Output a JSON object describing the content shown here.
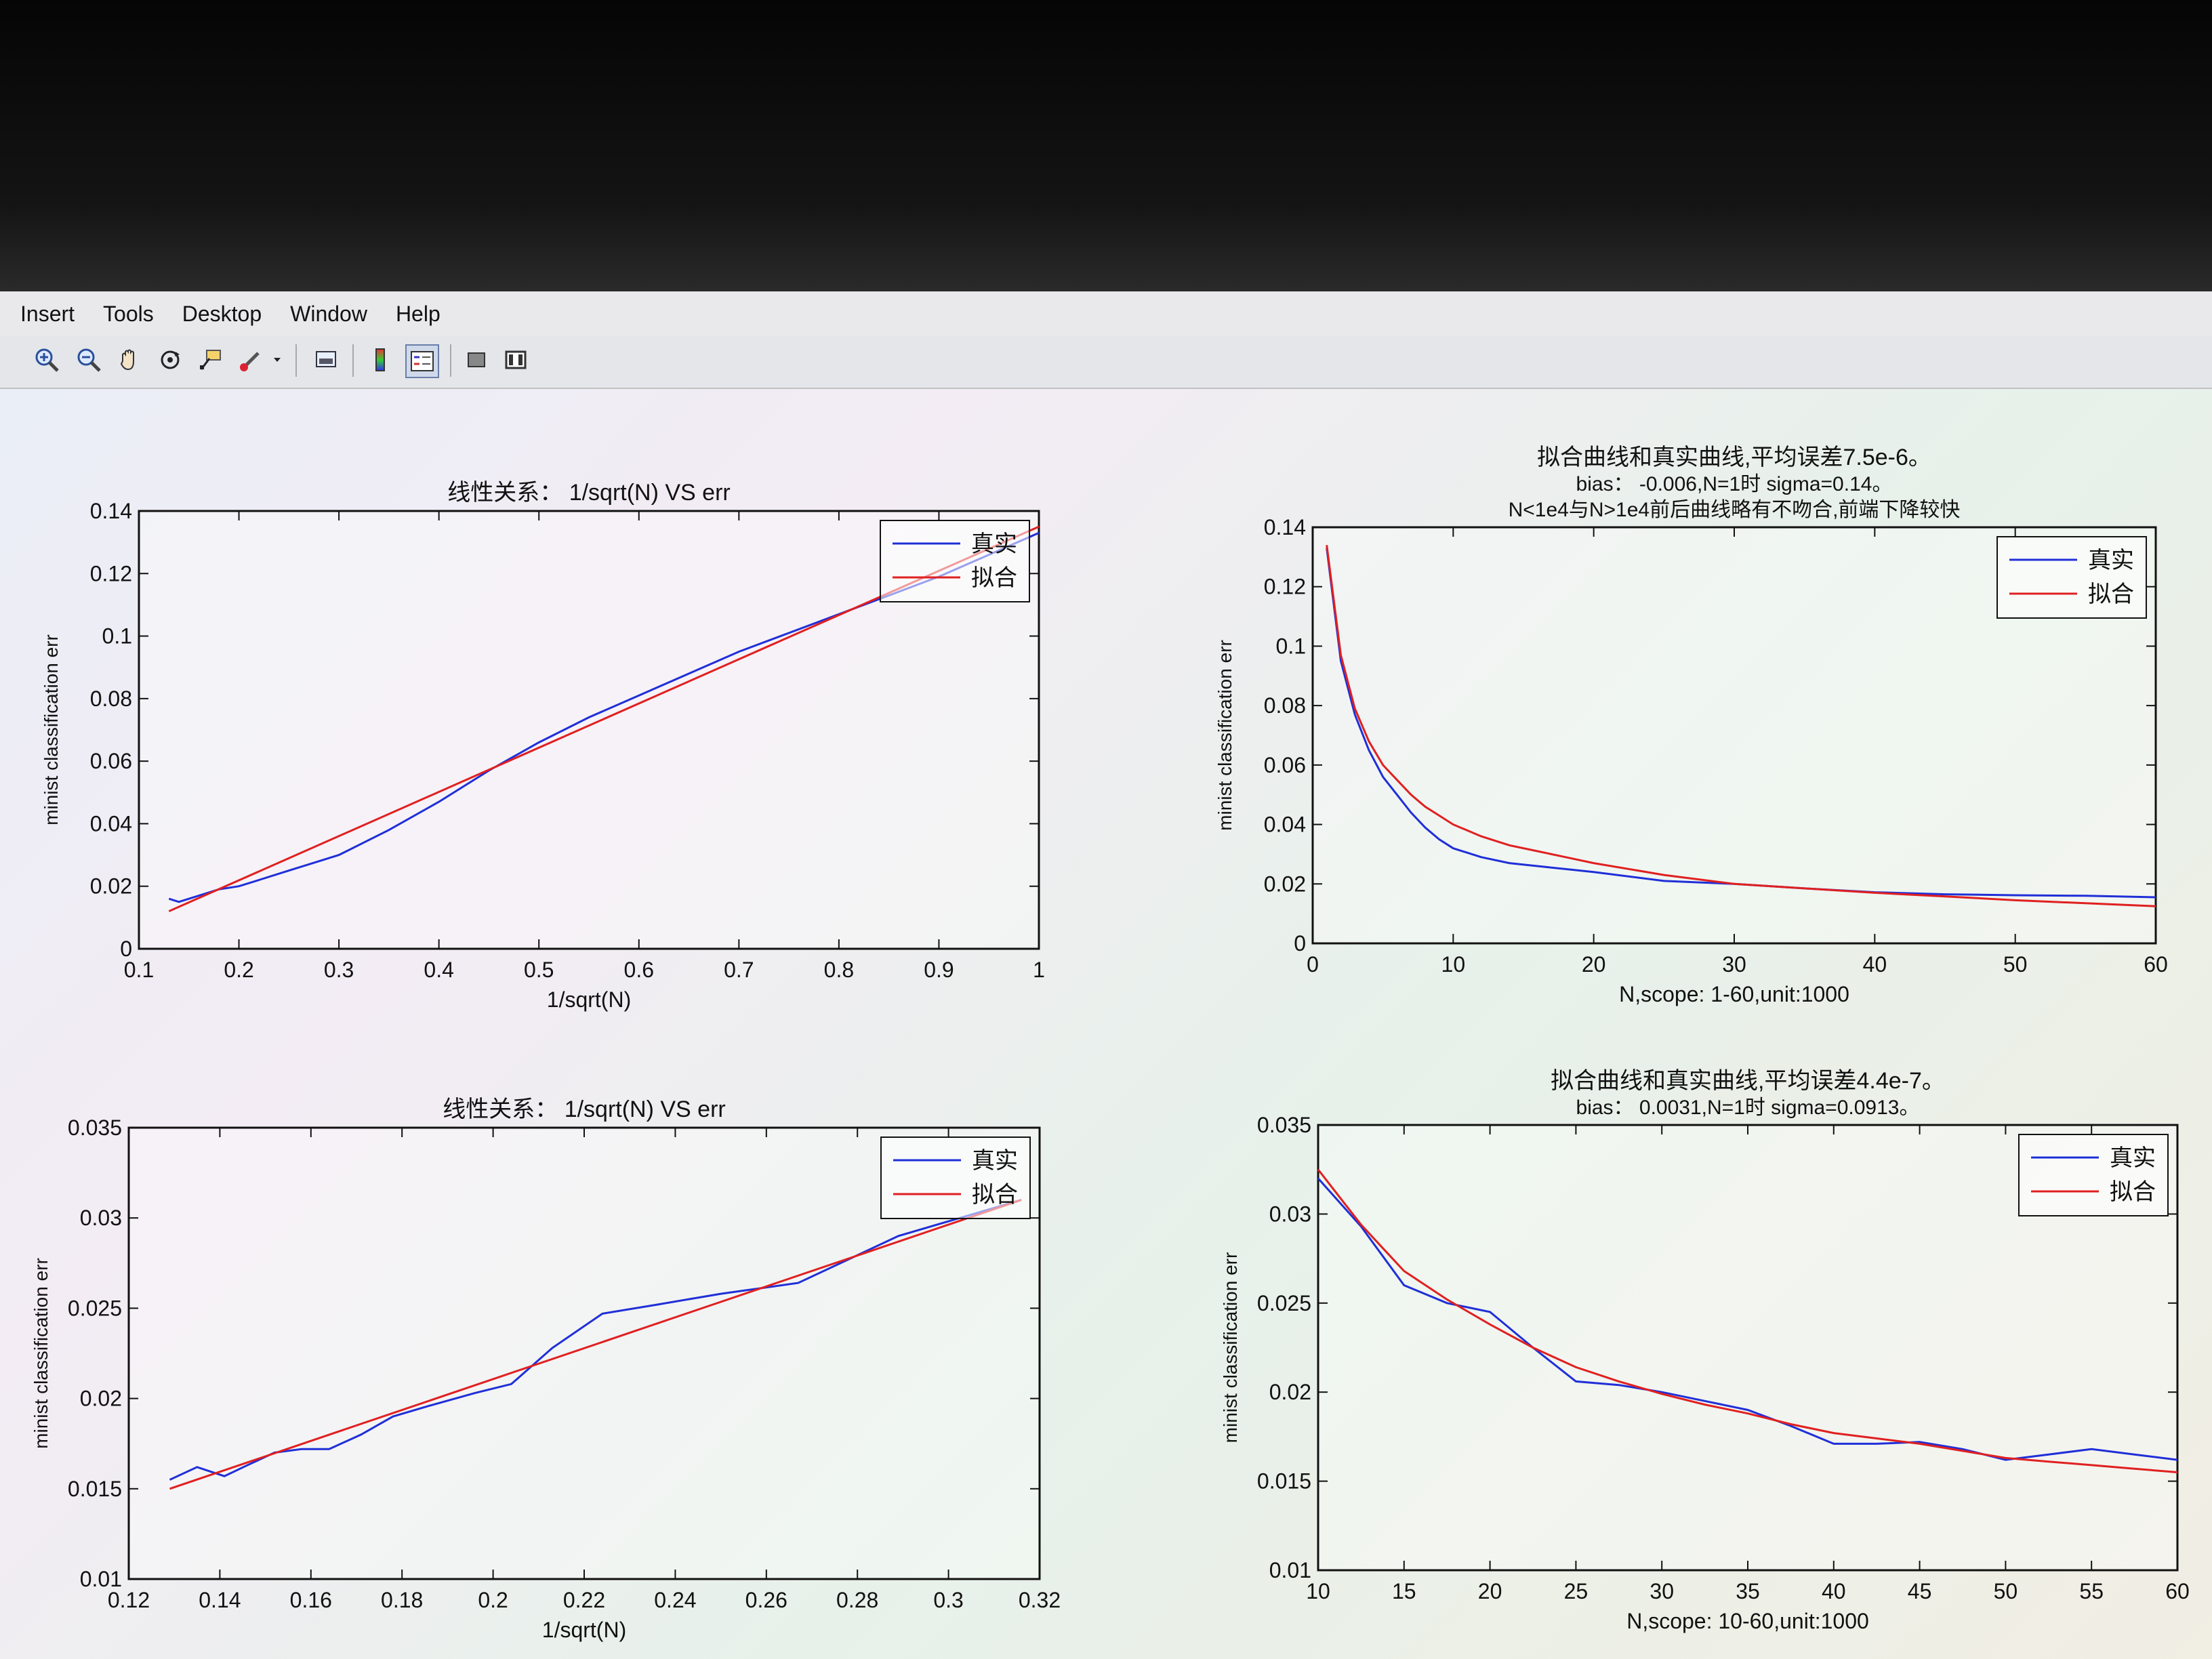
{
  "menu": [
    "Insert",
    "Tools",
    "Desktop",
    "Window",
    "Help"
  ],
  "toolbar_icons": [
    "zoom-in-icon",
    "zoom-out-icon",
    "pan-hand-icon",
    "rotate-3d-icon",
    "data-cursor-icon",
    "brush-icon",
    "dropdown-arrow-icon",
    "link-plot-icon",
    "colorbar-icon",
    "legend-icon",
    "hide-plot-tools-icon",
    "show-plot-tools-icon"
  ],
  "colors": {
    "real": "#1f2fd8",
    "fit": "#e02020"
  },
  "chart_data": [
    {
      "type": "line",
      "title": [
        "线性关系： 1/sqrt(N) VS err"
      ],
      "xlabel": "1/sqrt(N)",
      "ylabel": "minist classification err",
      "xlim": [
        0.1,
        1
      ],
      "ylim": [
        0,
        0.14
      ],
      "xticks": [
        0.1,
        0.2,
        0.3,
        0.4,
        0.5,
        0.6,
        0.7,
        0.8,
        0.9,
        1
      ],
      "xtick_labels": [
        "0.1",
        "0.2",
        "0.3",
        "0.4",
        "0.5",
        "0.6",
        "0.7",
        "0.8",
        "0.9",
        "1"
      ],
      "yticks": [
        0,
        0.02,
        0.04,
        0.06,
        0.08,
        0.1,
        0.12,
        0.14
      ],
      "ytick_labels": [
        "0",
        "0.02",
        "0.04",
        "0.06",
        "0.08",
        "0.1",
        "0.12",
        "0.14"
      ],
      "legend": "top-right",
      "grid": false,
      "series": [
        {
          "name": "真实",
          "color": "#1f2fd8",
          "x": [
            0.13,
            0.14,
            0.16,
            0.18,
            0.2,
            0.22,
            0.25,
            0.3,
            0.35,
            0.4,
            0.45,
            0.5,
            0.55,
            0.6,
            0.65,
            0.7,
            0.75,
            0.8,
            0.85,
            0.9,
            0.95,
            1.0
          ],
          "y": [
            0.016,
            0.015,
            0.017,
            0.019,
            0.02,
            0.022,
            0.025,
            0.03,
            0.038,
            0.047,
            0.057,
            0.066,
            0.074,
            0.081,
            0.088,
            0.095,
            0.101,
            0.107,
            0.113,
            0.119,
            0.126,
            0.133
          ]
        },
        {
          "name": "拟合",
          "color": "#e02020",
          "x": [
            0.13,
            1.0
          ],
          "y": [
            0.012,
            0.135
          ]
        }
      ]
    },
    {
      "type": "line",
      "title": [
        "拟合曲线和真实曲线,平均误差7.5e-6。",
        "bias： -0.006,N=1时 sigma=0.14。",
        "N<1e4与N>1e4前后曲线略有不吻合,前端下降较快"
      ],
      "xlabel": "N,scope: 1-60,unit:1000",
      "ylabel": "minist classification err",
      "xlim": [
        0,
        60
      ],
      "ylim": [
        0,
        0.14
      ],
      "xticks": [
        0,
        10,
        20,
        30,
        40,
        50,
        60
      ],
      "xtick_labels": [
        "0",
        "10",
        "20",
        "30",
        "40",
        "50",
        "60"
      ],
      "yticks": [
        0,
        0.02,
        0.04,
        0.06,
        0.08,
        0.1,
        0.12,
        0.14
      ],
      "ytick_labels": [
        "0",
        "0.02",
        "0.04",
        "0.06",
        "0.08",
        "0.1",
        "0.12",
        "0.14"
      ],
      "legend": "top-right",
      "grid": false,
      "series": [
        {
          "name": "真实",
          "color": "#1f2fd8",
          "x": [
            1,
            2,
            3,
            4,
            5,
            6,
            7,
            8,
            9,
            10,
            12,
            14,
            16,
            18,
            20,
            25,
            30,
            35,
            40,
            45,
            50,
            55,
            60
          ],
          "y": [
            0.133,
            0.095,
            0.077,
            0.065,
            0.056,
            0.05,
            0.044,
            0.039,
            0.035,
            0.032,
            0.029,
            0.027,
            0.026,
            0.025,
            0.024,
            0.021,
            0.02,
            0.0185,
            0.0172,
            0.0165,
            0.0162,
            0.016,
            0.0155
          ]
        },
        {
          "name": "拟合",
          "color": "#e02020",
          "x": [
            1,
            2,
            3,
            4,
            5,
            6,
            7,
            8,
            9,
            10,
            12,
            14,
            16,
            18,
            20,
            25,
            30,
            35,
            40,
            45,
            50,
            55,
            60
          ],
          "y": [
            0.134,
            0.097,
            0.079,
            0.068,
            0.06,
            0.055,
            0.05,
            0.046,
            0.043,
            0.04,
            0.036,
            0.033,
            0.031,
            0.029,
            0.027,
            0.023,
            0.02,
            0.0185,
            0.017,
            0.0158,
            0.0145,
            0.0135,
            0.0125
          ]
        }
      ]
    },
    {
      "type": "line",
      "title": [
        "线性关系： 1/sqrt(N) VS err"
      ],
      "xlabel": "1/sqrt(N)",
      "ylabel": "minist classification err",
      "xlim": [
        0.12,
        0.32
      ],
      "ylim": [
        0.01,
        0.035
      ],
      "xticks": [
        0.12,
        0.14,
        0.16,
        0.18,
        0.2,
        0.22,
        0.24,
        0.26,
        0.28,
        0.3,
        0.32
      ],
      "xtick_labels": [
        "0.12",
        "0.14",
        "0.16",
        "0.18",
        "0.2",
        "0.22",
        "0.24",
        "0.26",
        "0.28",
        "0.3",
        "0.32"
      ],
      "yticks": [
        0.01,
        0.015,
        0.02,
        0.025,
        0.03,
        0.035
      ],
      "ytick_labels": [
        "0.01",
        "0.015",
        "0.02",
        "0.025",
        "0.03",
        "0.035"
      ],
      "legend": "top-right",
      "grid": false,
      "series": [
        {
          "name": "真实",
          "color": "#1f2fd8",
          "x": [
            0.129,
            0.135,
            0.141,
            0.146,
            0.152,
            0.158,
            0.164,
            0.171,
            0.178,
            0.186,
            0.196,
            0.204,
            0.213,
            0.224,
            0.236,
            0.25,
            0.267,
            0.289,
            0.316
          ],
          "y": [
            0.0155,
            0.0162,
            0.0157,
            0.0163,
            0.017,
            0.0172,
            0.0172,
            0.018,
            0.019,
            0.0196,
            0.0203,
            0.0208,
            0.0228,
            0.0247,
            0.0252,
            0.0258,
            0.0264,
            0.029,
            0.031
          ]
        },
        {
          "name": "拟合",
          "color": "#e02020",
          "x": [
            0.129,
            0.316
          ],
          "y": [
            0.015,
            0.031
          ]
        }
      ]
    },
    {
      "type": "line",
      "title": [
        "拟合曲线和真实曲线,平均误差4.4e-7。",
        "bias： 0.0031,N=1时 sigma=0.0913。"
      ],
      "xlabel": "N,scope: 10-60,unit:1000",
      "ylabel": "minist classification err",
      "xlim": [
        10,
        60
      ],
      "ylim": [
        0.01,
        0.035
      ],
      "xticks": [
        10,
        15,
        20,
        25,
        30,
        35,
        40,
        45,
        50,
        55,
        60
      ],
      "xtick_labels": [
        "10",
        "15",
        "20",
        "25",
        "30",
        "35",
        "40",
        "45",
        "50",
        "55",
        "60"
      ],
      "yticks": [
        0.01,
        0.015,
        0.02,
        0.025,
        0.03,
        0.035
      ],
      "ytick_labels": [
        "0.01",
        "0.015",
        "0.02",
        "0.025",
        "0.03",
        "0.035"
      ],
      "legend": "top-right",
      "grid": false,
      "series": [
        {
          "name": "真实",
          "color": "#1f2fd8",
          "x": [
            10,
            12.5,
            15,
            17.5,
            20,
            22.5,
            25,
            27.5,
            30,
            32.5,
            35,
            37.5,
            40,
            42.5,
            45,
            47.5,
            50,
            52.5,
            55,
            57.5,
            60
          ],
          "y": [
            0.032,
            0.0293,
            0.026,
            0.025,
            0.0245,
            0.0225,
            0.0206,
            0.0204,
            0.02,
            0.0195,
            0.019,
            0.0181,
            0.0171,
            0.0171,
            0.0172,
            0.0168,
            0.0162,
            0.0165,
            0.0168,
            0.0165,
            0.0162
          ]
        },
        {
          "name": "拟合",
          "color": "#e02020",
          "x": [
            10,
            12.5,
            15,
            17.5,
            20,
            22.5,
            25,
            27.5,
            30,
            32.5,
            35,
            37.5,
            40,
            42.5,
            45,
            47.5,
            50,
            52.5,
            55,
            57.5,
            60
          ],
          "y": [
            0.0325,
            0.0294,
            0.0268,
            0.0252,
            0.0238,
            0.0225,
            0.0214,
            0.0206,
            0.0199,
            0.0193,
            0.0188,
            0.0182,
            0.0177,
            0.0174,
            0.0171,
            0.0167,
            0.0163,
            0.0161,
            0.0159,
            0.0157,
            0.0155
          ]
        }
      ]
    }
  ]
}
